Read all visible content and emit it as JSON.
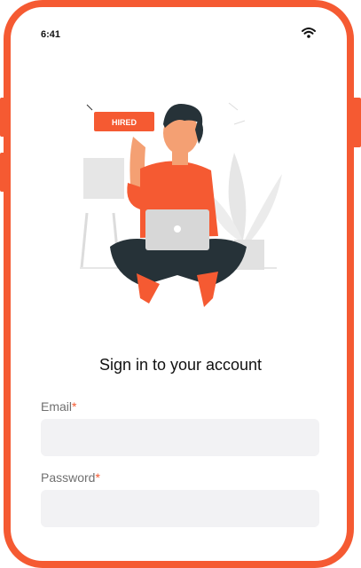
{
  "status_bar": {
    "time": "6:41",
    "wifi_icon": "wifi-icon"
  },
  "illustration": {
    "badge_text": "HIRED"
  },
  "signin": {
    "title": "Sign in to your account",
    "email_label": "Email",
    "password_label": "Password",
    "required_mark": "*",
    "email_value": "",
    "password_value": ""
  },
  "colors": {
    "accent": "#f55a32",
    "input_bg": "#f2f2f4"
  }
}
